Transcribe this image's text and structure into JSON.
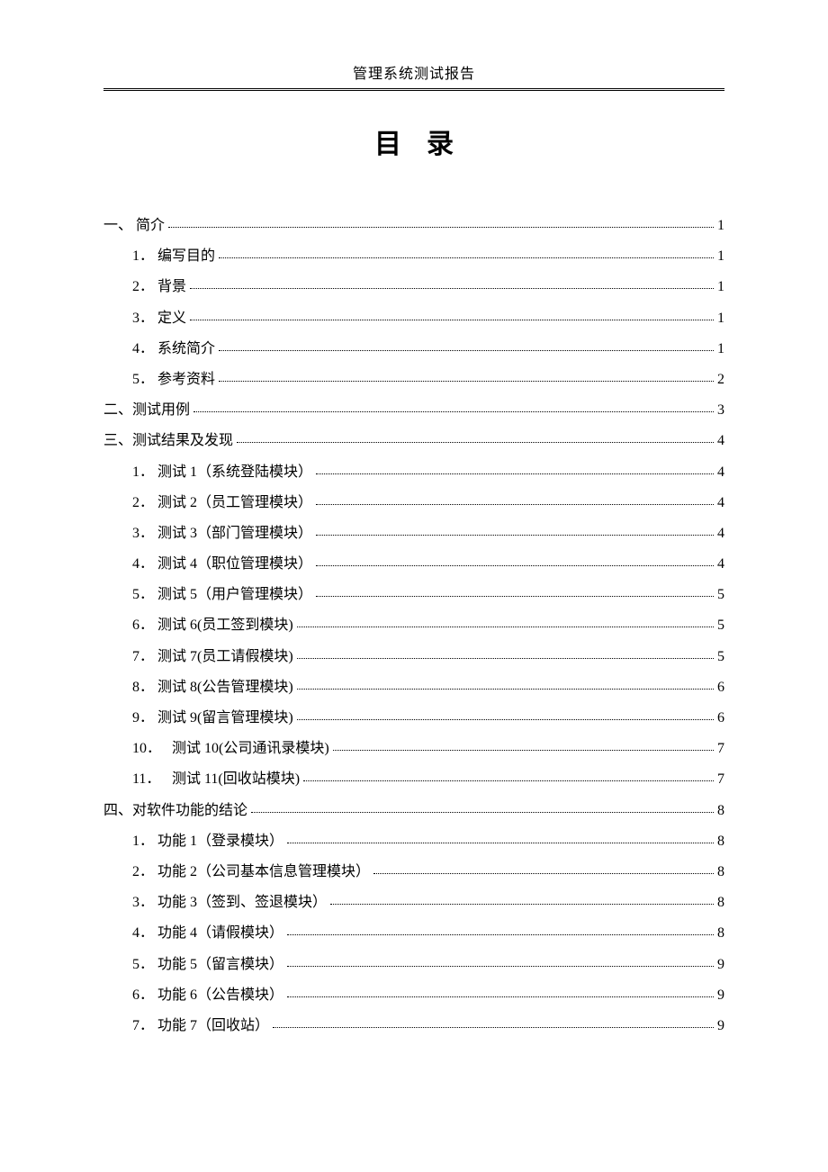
{
  "header_title": "管理系统测试报告",
  "main_title": "目录",
  "entries": [
    {
      "level": 0,
      "num": "一、",
      "label": "简介",
      "page": "1",
      "numwide": false,
      "space": true
    },
    {
      "level": 1,
      "num": "1．",
      "label": "编写目的",
      "page": "1",
      "numwide": true
    },
    {
      "level": 1,
      "num": "2．",
      "label": "背景",
      "page": "1",
      "numwide": true
    },
    {
      "level": 1,
      "num": "3．",
      "label": "定义",
      "page": "1",
      "numwide": true
    },
    {
      "level": 1,
      "num": "4．",
      "label": "系统简介",
      "page": "1",
      "numwide": true
    },
    {
      "level": 1,
      "num": "5．",
      "label": "参考资料",
      "page": "2",
      "numwide": true
    },
    {
      "level": 0,
      "num": "二、",
      "label": "测试用例",
      "page": "3",
      "numwide": false
    },
    {
      "level": 0,
      "num": "三、",
      "label": "测试结果及发现",
      "page": "4",
      "numwide": false
    },
    {
      "level": 1,
      "num": "1．",
      "label": "测试 1（系统登陆模块）",
      "page": "4",
      "numwide": true
    },
    {
      "level": 1,
      "num": "2．",
      "label": "测试 2（员工管理模块）",
      "page": "4",
      "numwide": true
    },
    {
      "level": 1,
      "num": "3．",
      "label": "测试 3（部门管理模块）",
      "page": "4",
      "numwide": true
    },
    {
      "level": 1,
      "num": "4．",
      "label": "测试 4（职位管理模块）",
      "page": "4",
      "numwide": true
    },
    {
      "level": 1,
      "num": "5．",
      "label": "测试 5（用户管理模块）",
      "page": "5",
      "numwide": true
    },
    {
      "level": 1,
      "num": "6．",
      "label": "测试 6(员工签到模块)",
      "page": "5",
      "numwide": true
    },
    {
      "level": 1,
      "num": "7．",
      "label": "测试 7(员工请假模块)",
      "page": "5",
      "numwide": true
    },
    {
      "level": 1,
      "num": "8．",
      "label": "测试 8(公告管理模块)",
      "page": "6",
      "numwide": true
    },
    {
      "level": 1,
      "num": "9．",
      "label": "测试 9(留言管理模块)",
      "page": "6",
      "numwide": true
    },
    {
      "level": 1,
      "num": "10．",
      "label": "测试 10(公司通讯录模块)",
      "page": "7",
      "numwide": true,
      "wide": true
    },
    {
      "level": 1,
      "num": "11．",
      "label": "测试 11(回收站模块)",
      "page": "7",
      "numwide": true,
      "wide": true
    },
    {
      "level": 0,
      "num": "四、",
      "label": "对软件功能的结论",
      "page": "8",
      "numwide": false
    },
    {
      "level": 1,
      "num": "1．",
      "label": "功能 1（登录模块）",
      "page": "8",
      "numwide": true
    },
    {
      "level": 1,
      "num": "2．",
      "label": "功能 2（公司基本信息管理模块）",
      "page": "8",
      "numwide": true
    },
    {
      "level": 1,
      "num": "3．",
      "label": "功能 3（签到、签退模块）",
      "page": "8",
      "numwide": true
    },
    {
      "level": 1,
      "num": "4．",
      "label": "功能 4（请假模块）",
      "page": "8",
      "numwide": true
    },
    {
      "level": 1,
      "num": "5．",
      "label": "功能 5（留言模块）",
      "page": "9",
      "numwide": true
    },
    {
      "level": 1,
      "num": "6．",
      "label": "功能 6（公告模块）",
      "page": "9",
      "numwide": true
    },
    {
      "level": 1,
      "num": "7．",
      "label": "功能 7（回收站）",
      "page": "9",
      "numwide": true
    }
  ]
}
